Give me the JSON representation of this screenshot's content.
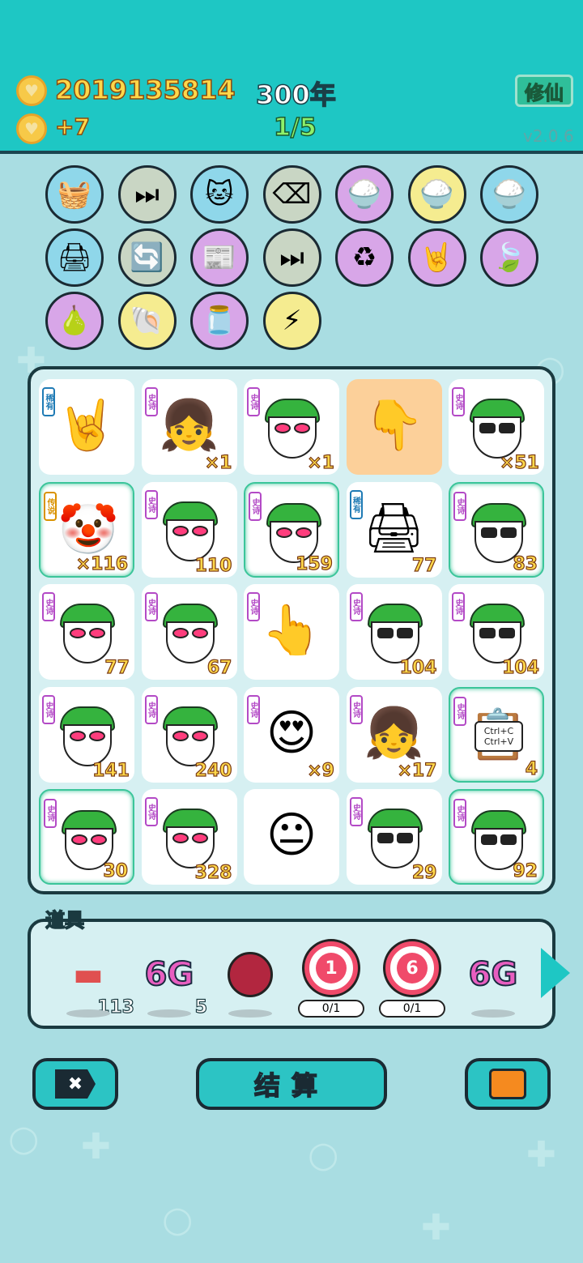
{
  "header": {
    "coins": "2019135814",
    "coin_rate": "+7",
    "years": "300年",
    "progress": "1/5",
    "xiuxian_label": "修仙",
    "version": "v2.0.6"
  },
  "skills": [
    {
      "name": "fruit-basket",
      "glyph": "🧺",
      "bg": "#8fd7ea"
    },
    {
      "name": "skip",
      "glyph": "⏭",
      "bg": "#c9d6c4"
    },
    {
      "name": "cat",
      "glyph": "🐱",
      "bg": "#8fd7ea"
    },
    {
      "name": "delete",
      "glyph": "⌫",
      "bg": "#c9d6c4"
    },
    {
      "name": "rice-bowl",
      "glyph": "🍚",
      "bg": "#d8a6e8"
    },
    {
      "name": "rice-bowl",
      "glyph": "🍚",
      "bg": "#f5ec90"
    },
    {
      "name": "rice-bowl",
      "glyph": "🍚",
      "bg": "#8fd7ea"
    },
    {
      "name": "printer",
      "glyph": "🖨",
      "bg": "#8fd7ea"
    },
    {
      "name": "refresh",
      "glyph": "🔄",
      "bg": "#c9d6c4"
    },
    {
      "name": "time-magazine",
      "glyph": "📰",
      "bg": "#d8a6e8"
    },
    {
      "name": "skip",
      "glyph": "⏭",
      "bg": "#c9d6c4"
    },
    {
      "name": "recycle",
      "glyph": "♻",
      "bg": "#d8a6e8"
    },
    {
      "name": "rock-hand",
      "glyph": "🤘",
      "bg": "#d8a6e8"
    },
    {
      "name": "leaf",
      "glyph": "🍃",
      "bg": "#d8a6e8"
    },
    {
      "name": "pomelo",
      "glyph": "🍐",
      "bg": "#d8a6e8"
    },
    {
      "name": "shell",
      "glyph": "🐚",
      "bg": "#f5ec90"
    },
    {
      "name": "jar",
      "glyph": "🫙",
      "bg": "#d8a6e8"
    },
    {
      "name": "lightning",
      "glyph": "⚡",
      "bg": "#f5ec90"
    }
  ],
  "board": [
    {
      "tag": "稀有",
      "tagType": "rare",
      "kind": "emoji",
      "glyph": "🤘",
      "count": ""
    },
    {
      "tag": "史诗",
      "tagType": "epic",
      "kind": "emoji",
      "glyph": "👧",
      "count": "×1"
    },
    {
      "tag": "史诗",
      "tagType": "epic",
      "kind": "face",
      "eyes": "heart",
      "count": "×1"
    },
    {
      "tag": "",
      "tagType": "",
      "kind": "emoji",
      "glyph": "👇",
      "count": "",
      "orange": true
    },
    {
      "tag": "史诗",
      "tagType": "epic",
      "kind": "face",
      "eyes": "sun",
      "count": "×51"
    },
    {
      "tag": "传说",
      "tagType": "legend",
      "kind": "emoji",
      "glyph": "🤡",
      "count": "×116",
      "glow": true
    },
    {
      "tag": "史诗",
      "tagType": "epic",
      "kind": "face",
      "eyes": "heart",
      "count": "110"
    },
    {
      "tag": "史诗",
      "tagType": "epic",
      "kind": "face",
      "eyes": "heart",
      "count": "159",
      "glow": true
    },
    {
      "tag": "稀有",
      "tagType": "rare",
      "kind": "emoji",
      "glyph": "🖨",
      "count": "77"
    },
    {
      "tag": "史诗",
      "tagType": "epic",
      "kind": "face",
      "eyes": "sun",
      "count": "83",
      "glow": true
    },
    {
      "tag": "史诗",
      "tagType": "epic",
      "kind": "face",
      "eyes": "heart",
      "count": "77"
    },
    {
      "tag": "史诗",
      "tagType": "epic",
      "kind": "face",
      "eyes": "heart",
      "count": "67"
    },
    {
      "tag": "史诗",
      "tagType": "epic",
      "kind": "emoji",
      "glyph": "👆",
      "count": ""
    },
    {
      "tag": "史诗",
      "tagType": "epic",
      "kind": "face",
      "eyes": "sun",
      "count": "104"
    },
    {
      "tag": "史诗",
      "tagType": "epic",
      "kind": "face",
      "eyes": "sun",
      "count": "104"
    },
    {
      "tag": "史诗",
      "tagType": "epic",
      "kind": "face",
      "eyes": "heart",
      "count": "141"
    },
    {
      "tag": "史诗",
      "tagType": "epic",
      "kind": "face",
      "eyes": "heart",
      "count": "240"
    },
    {
      "tag": "史诗",
      "tagType": "epic",
      "kind": "emoji",
      "glyph": "😍",
      "count": "×9"
    },
    {
      "tag": "史诗",
      "tagType": "epic",
      "kind": "emoji",
      "glyph": "👧",
      "count": "×17"
    },
    {
      "tag": "史诗",
      "tagType": "epic",
      "kind": "emoji",
      "glyph": "📋",
      "count": "4",
      "glow": true,
      "note": "Ctrl+C Ctrl+V"
    },
    {
      "tag": "史诗",
      "tagType": "epic",
      "kind": "face",
      "eyes": "heart",
      "count": "30",
      "glow": true
    },
    {
      "tag": "史诗",
      "tagType": "epic",
      "kind": "face",
      "eyes": "heart",
      "count": "328"
    },
    {
      "tag": "",
      "tagType": "",
      "kind": "emoji",
      "glyph": "😐",
      "count": ""
    },
    {
      "tag": "史诗",
      "tagType": "epic",
      "kind": "face",
      "eyes": "sun",
      "count": "29"
    },
    {
      "tag": "史诗",
      "tagType": "epic",
      "kind": "face",
      "eyes": "sun",
      "count": "92",
      "glow": true
    }
  ],
  "items_label": "道具",
  "items": [
    {
      "name": "liver",
      "count": "113"
    },
    {
      "name": "6g",
      "text": "6G",
      "count": "5"
    },
    {
      "name": "bayberry",
      "count": ""
    },
    {
      "name": "target-1",
      "text": "1",
      "sub": "0/1"
    },
    {
      "name": "target-6",
      "text": "6",
      "sub": "0/1"
    },
    {
      "name": "6g",
      "text": "6G",
      "count": ""
    }
  ],
  "buttons": {
    "settle_label": "结算"
  }
}
